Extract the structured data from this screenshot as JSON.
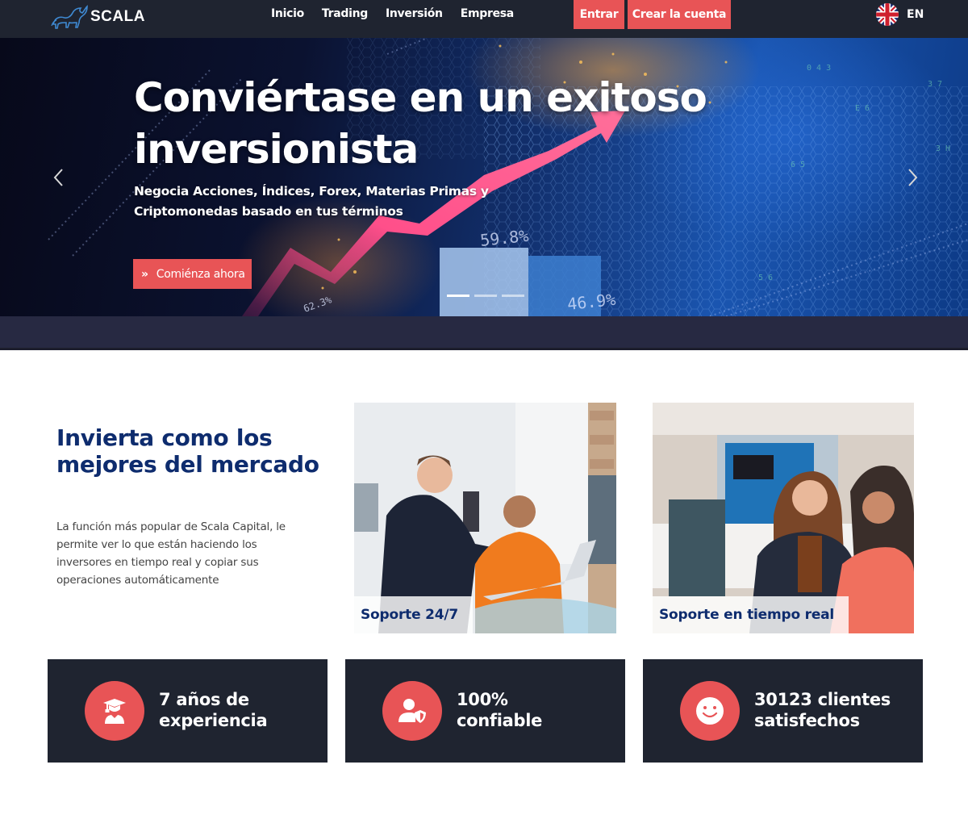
{
  "brand": {
    "name": "SCALA",
    "accent": "#e85456",
    "navy": "#0e2c6e",
    "dark": "#1f2430"
  },
  "nav": {
    "links": [
      "Inicio",
      "Trading",
      "Inversión",
      "Empresa"
    ],
    "login_label": "Entrar",
    "signup_label": "Crear la cuenta",
    "language": {
      "icon": "uk-flag-icon",
      "label": "EN"
    }
  },
  "hero": {
    "title": "Conviértase en un exitoso inversionista",
    "subtitle": "Negocia Acciones, Índices, Forex, Materias Primas y Criptomonedas basado en tus términos",
    "cta_label": "Comiénza ahora",
    "cta_icon": "double-chevron-right-icon",
    "prev_icon": "chevron-left-icon",
    "next_icon": "chevron-right-icon",
    "slides_total": 3,
    "slide_active": 1,
    "image_numbers": [
      "59.8%",
      "46.9%",
      "62.3%"
    ]
  },
  "invest": {
    "title": "Invierta como los mejores del mercado",
    "text": "La función más popular de Scala Capital, le permite ver lo que están haciendo los inversores en tiempo real y copiar sus operaciones automáticamente"
  },
  "photos": [
    {
      "caption": "Soporte 24/7"
    },
    {
      "caption": "Soporte en tiempo real"
    }
  ],
  "stats": [
    {
      "icon": "graduate-icon",
      "text": "7 años de experiencia"
    },
    {
      "icon": "user-shield-icon",
      "text": "100% confiable"
    },
    {
      "icon": "smile-icon",
      "text": "30123 clientes satisfechos"
    }
  ]
}
